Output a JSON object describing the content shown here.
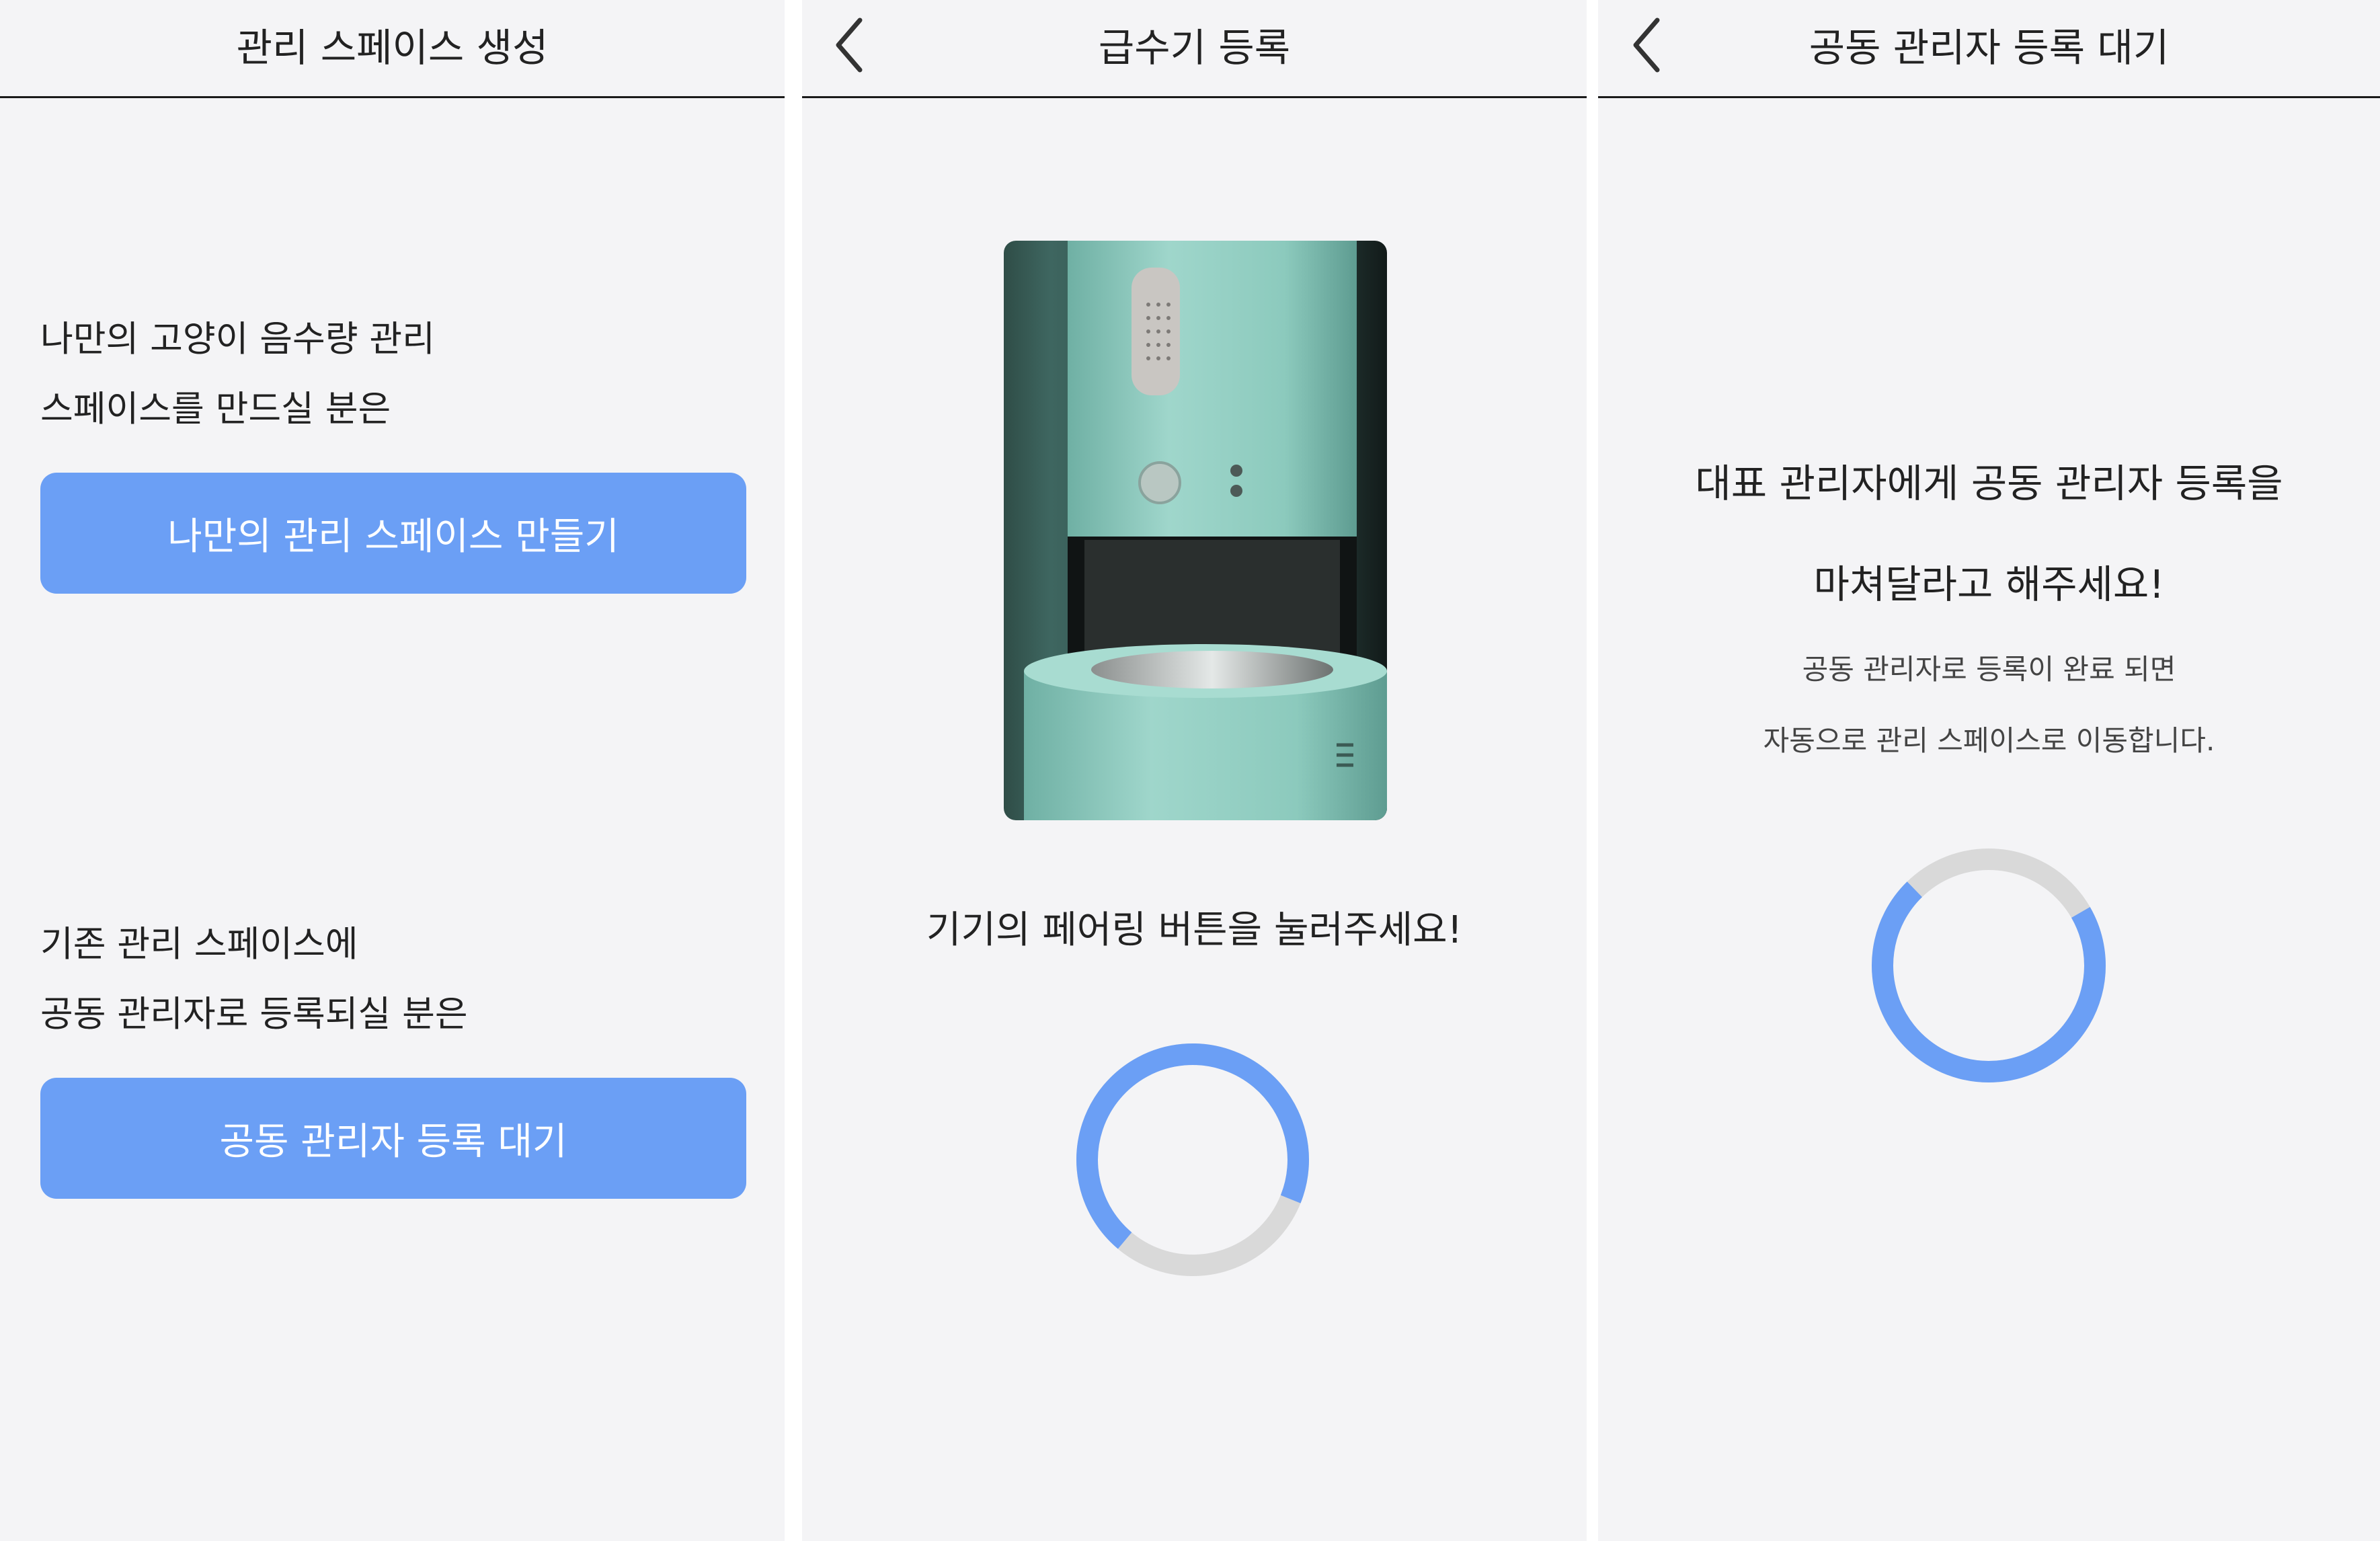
{
  "screen1": {
    "title": "관리 스페이스 생성",
    "new_prompt_line1": "나만의 고양이 음수량 관리",
    "new_prompt_line2": "스페이스를 만드실 분은",
    "create_button_label": "나만의 관리 스페이스 만들기",
    "join_prompt_line1": "기존 관리 스페이스에",
    "join_prompt_line2": "공동 관리자로 등록되실 분은",
    "join_button_label": "공동 관리자 등록 대기"
  },
  "screen2": {
    "title": "급수기 등록",
    "back_icon": "chevron-left-icon",
    "device_image": "cat-water-fountain-photo",
    "instruction": "기기의 페어링 버튼을 눌러주세요!",
    "spinner": "loading-spinner"
  },
  "screen3": {
    "title": "공동 관리자 등록 대기",
    "back_icon": "chevron-left-icon",
    "headline_line1": "대표 관리자에게 공동 관리자 등록을",
    "headline_line2": "마쳐달라고 해주세요!",
    "sub_line1": "공동 관리자로 등록이 완료 되면",
    "sub_line2": "자동으로 관리 스페이스로 이동합니다.",
    "spinner": "loading-spinner"
  },
  "colors": {
    "accent": "#6b9ff5",
    "background": "#f4f4f6",
    "spinner_track": "#d9d9d9",
    "text": "#222222"
  }
}
